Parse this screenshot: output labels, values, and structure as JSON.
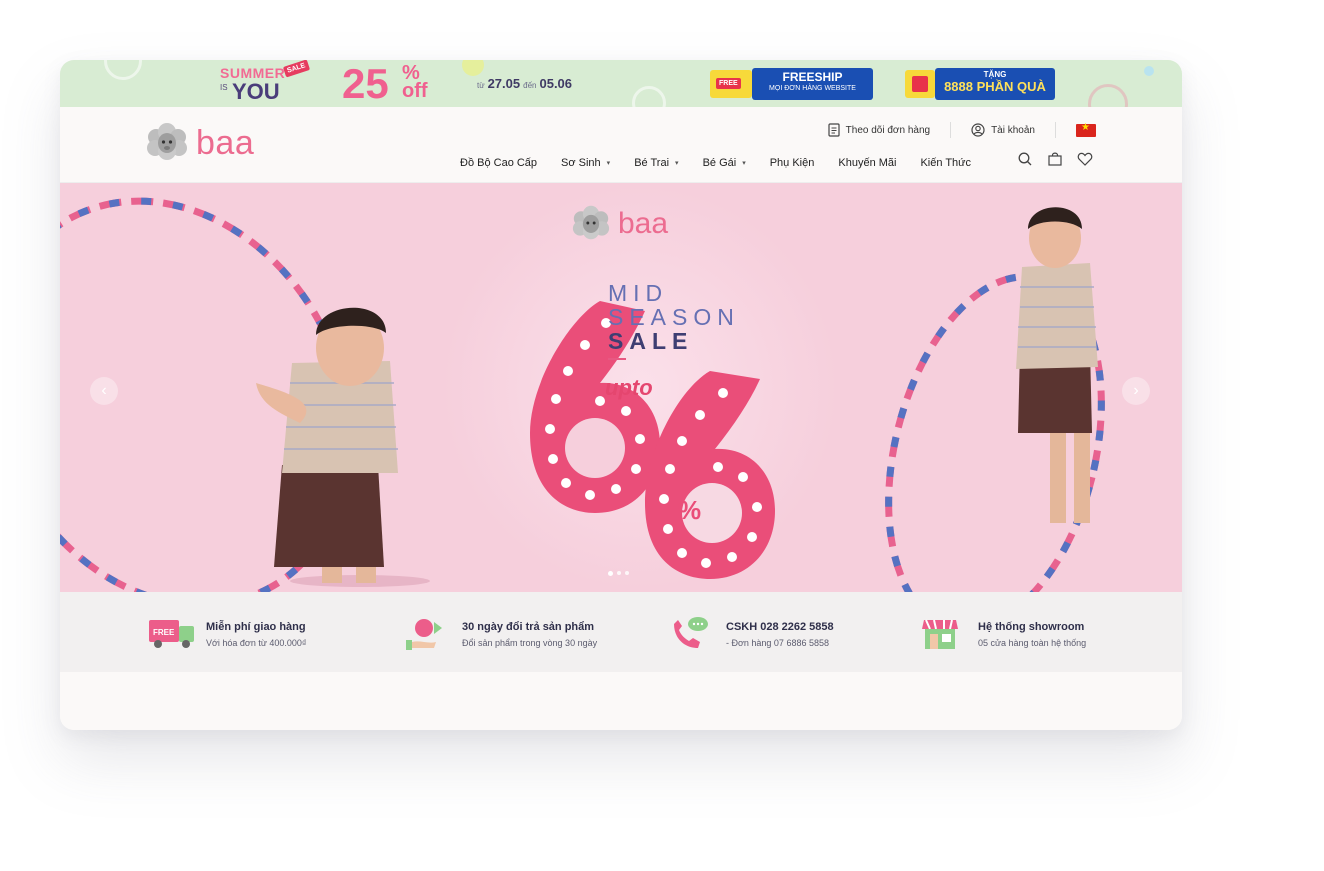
{
  "promo": {
    "summer_line1": "SUMMER",
    "summer_is": "IS",
    "summer_you": "YOU",
    "sale_tag": "SALE",
    "percent": "25",
    "percent_sign": "%",
    "percent_off": "off",
    "date_from_label": "từ",
    "date_from": "27.05",
    "date_to_label": "đến",
    "date_to": "05.06",
    "free_tag": "FREE",
    "freeship_title": "FREESHIP",
    "freeship_sub": "MỌI ĐƠN HÀNG WEBSITE",
    "gift_title": "TẶNG",
    "gift_sub": "8888 PHẦN QUÀ"
  },
  "header": {
    "logo_text": "baa",
    "track_order": "Theo dõi đơn hàng",
    "account": "Tài khoản",
    "nav": [
      {
        "label": "Đồ Bộ Cao Cấp",
        "dropdown": false
      },
      {
        "label": "Sơ Sinh",
        "dropdown": true
      },
      {
        "label": "Bé Trai",
        "dropdown": true
      },
      {
        "label": "Bé Gái",
        "dropdown": true
      },
      {
        "label": "Phụ Kiện",
        "dropdown": false
      },
      {
        "label": "Khuyến Mãi",
        "dropdown": false
      },
      {
        "label": "Kiến Thức",
        "dropdown": false
      }
    ],
    "caret": "▾"
  },
  "hero": {
    "logo_text": "baa",
    "mid": "MID",
    "season": "SEASON",
    "sale": "SALE",
    "upto": "upto",
    "big_number": "66",
    "percent": "%",
    "prev_arrow": "‹",
    "next_arrow": "›",
    "slides": 3,
    "active_slide": 1,
    "colors": {
      "bg": "#f6cfdc",
      "accent": "#e5466f",
      "navy": "#3e3e72"
    }
  },
  "features": [
    {
      "title": "Miễn phí giao hàng",
      "subtitle": "Với hóa đơn từ 400.000₫",
      "icon": "free-truck-icon"
    },
    {
      "title": "30 ngày đổi trả sản phẩm",
      "subtitle": "Đổi sản phẩm trong vòng 30 ngày",
      "icon": "return-icon"
    },
    {
      "title": "CSKH 028 2262 5858",
      "subtitle": "- Đơn hàng 07 6886 5858",
      "icon": "phone-icon"
    },
    {
      "title": "Hệ thống showroom",
      "subtitle": "05 cửa hàng toàn hệ thống",
      "icon": "store-icon"
    }
  ]
}
